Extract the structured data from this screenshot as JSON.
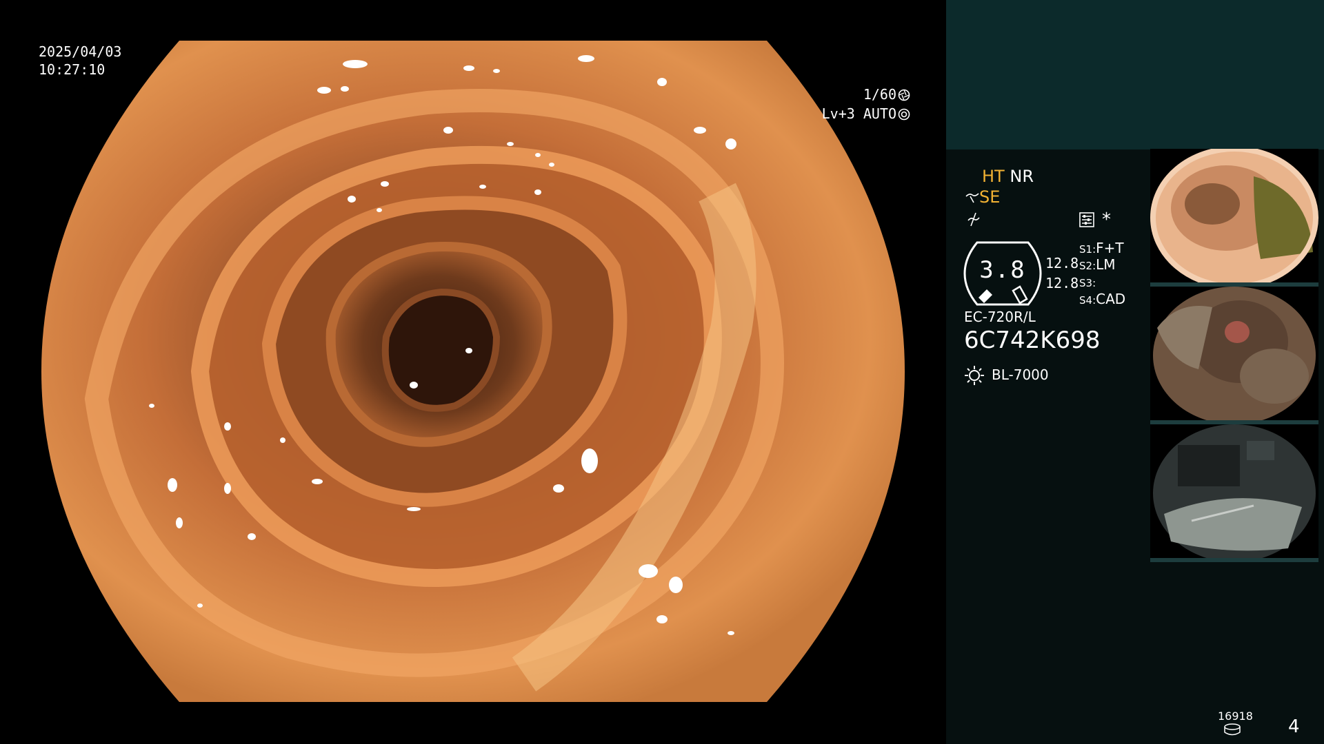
{
  "main_view": {
    "date": "2025/04/03",
    "time": "10:27:10",
    "shutter": "1/60",
    "level": "Lv+3 AUTO"
  },
  "side_panel": {
    "enhancement": {
      "ht": "HT",
      "nr": "NR",
      "se": "SE"
    },
    "asterisk": "*",
    "zoom_value": "3.8",
    "values": [
      "12.8",
      "12.8"
    ],
    "switch_assignments": [
      {
        "key": "S1:",
        "value": "F+T"
      },
      {
        "key": "S2:",
        "value": "LM"
      },
      {
        "key": "S3:",
        "value": ""
      },
      {
        "key": "S4:",
        "value": "CAD"
      }
    ],
    "scope_model": "EC-720R/L",
    "scope_serial": "6C742K698",
    "light_source": "BL-7000",
    "storage_count": "16918",
    "page_number": "4"
  },
  "icons": {
    "shutter": "aperture-icon",
    "level": "auto-iris-icon",
    "enhancement": "structure-enhance-icon",
    "freeze": "freeze-icon",
    "settings": "settings-panel-icon",
    "light": "light-source-icon",
    "storage": "storage-icon"
  },
  "colors": {
    "panel_background": "#061010",
    "panel_top": "#0c2a2b",
    "highlight": "#f2b233",
    "tissue": "#d7843e"
  }
}
